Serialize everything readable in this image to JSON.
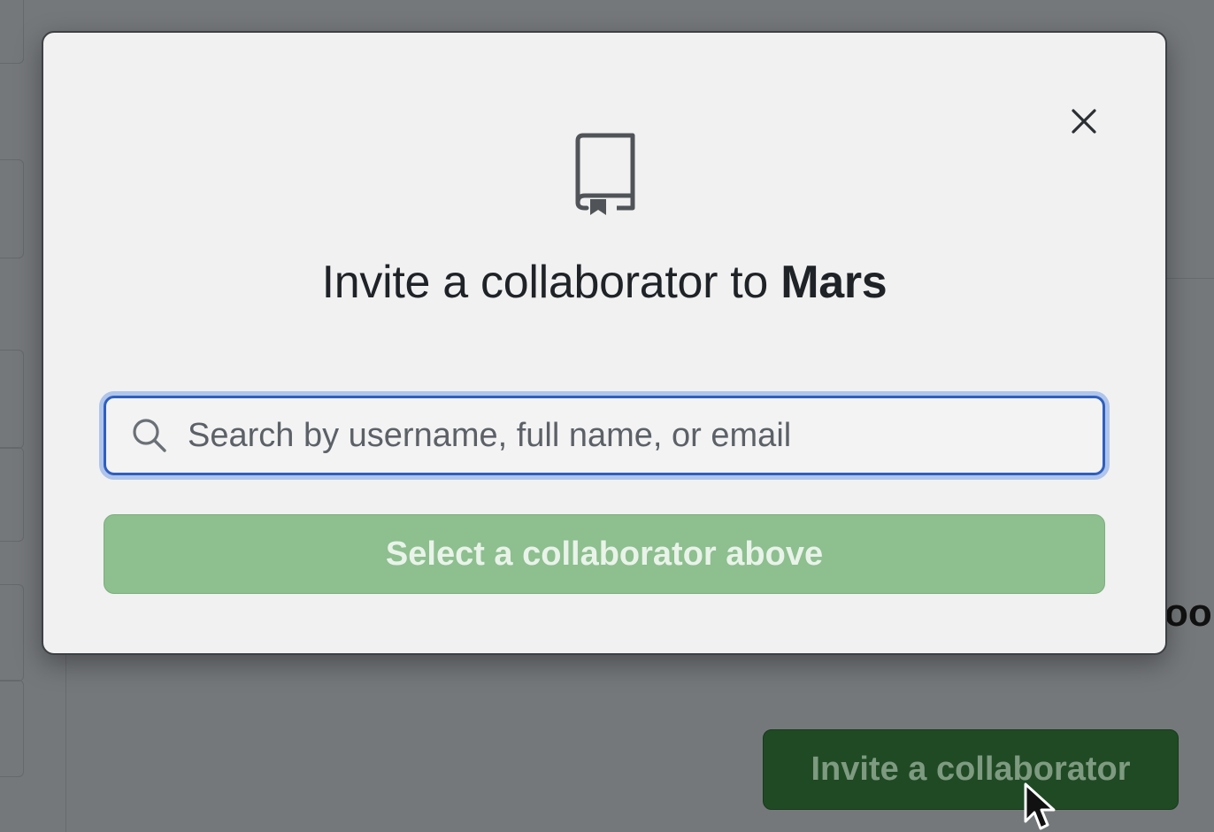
{
  "background": {
    "partial_heading": "oo",
    "invite_button_label": "Invite a collaborator"
  },
  "modal": {
    "title_prefix": "Invite a collaborator to ",
    "repo_name": "Mars",
    "search": {
      "placeholder": "Search by username, full name, or email",
      "value": ""
    },
    "submit_label": "Select a collaborator above",
    "submit_disabled": true,
    "icons": {
      "header": "repo-icon",
      "close": "close-icon",
      "search": "search-icon"
    }
  },
  "colors": {
    "accent_focus": "#2f5fbf",
    "primary_disabled": "#8dbf8f",
    "primary_dark": "#1f4a24"
  }
}
